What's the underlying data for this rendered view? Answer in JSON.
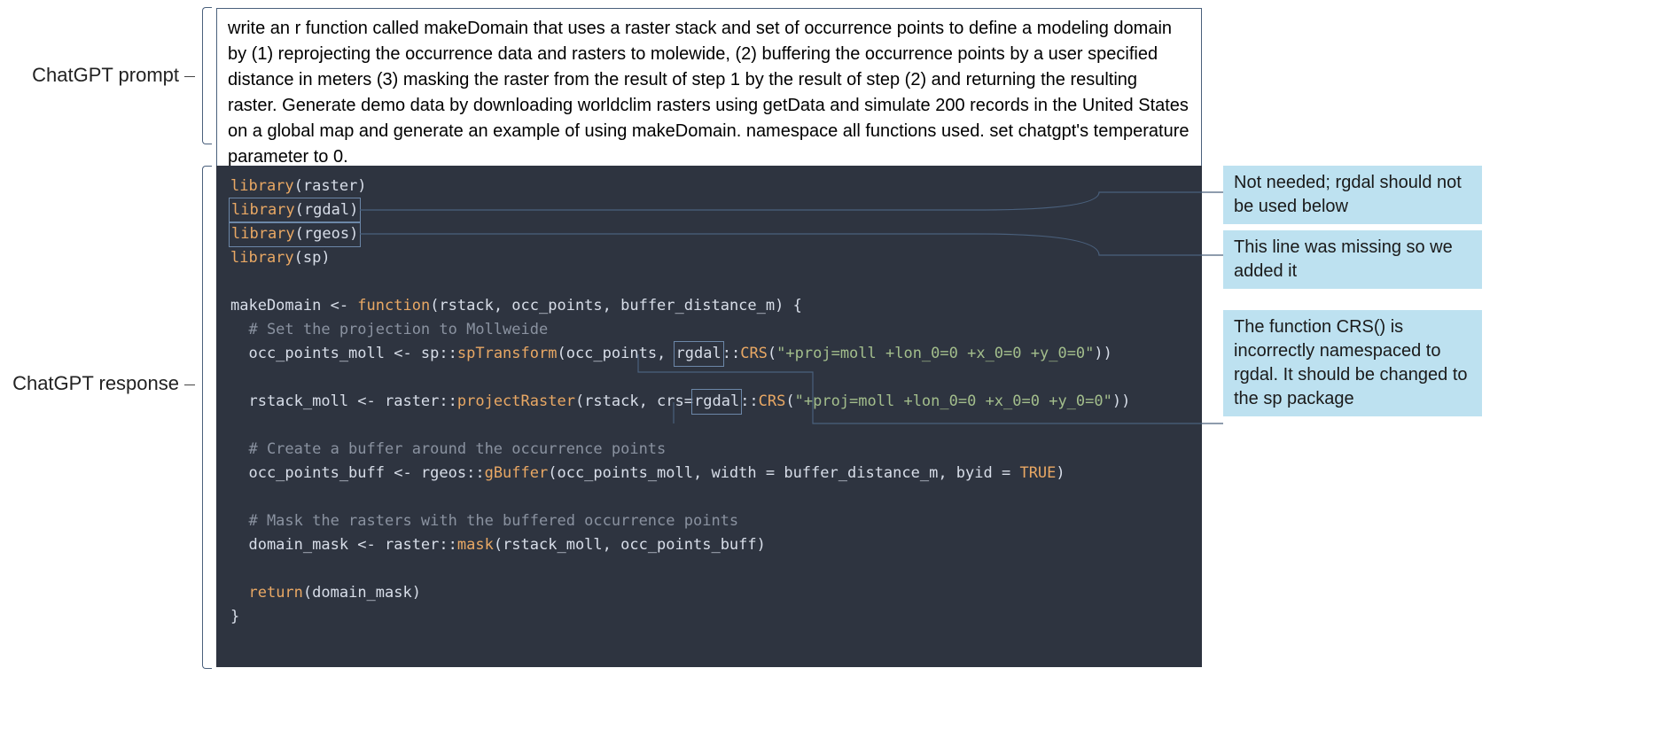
{
  "labels": {
    "prompt": "ChatGPT prompt",
    "response": "ChatGPT response"
  },
  "prompt_text": "write an r function called makeDomain that uses a raster stack and set of occurrence points to define a modeling domain by (1) reprojecting the occurrence data and rasters to molewide, (2) buffering the occurrence points by a user specified distance in meters (3) masking the raster from the result of step 1 by the result of step (2) and returning the resulting raster. Generate demo data by downloading worldclim rasters using getData and simulate 200 records in the United States on a global map and generate an example of using makeDomain. namespace all functions used. set chatgpt's temperature parameter to 0.",
  "code": {
    "l1_fn": "library",
    "l1_arg": "(raster)",
    "l2_fn": "library",
    "l2_arg": "(rgdal)",
    "l3_fn": "library",
    "l3_arg": "(rgeos)",
    "l4_fn": "library",
    "l4_arg": "(sp)",
    "l6a": "makeDomain <- ",
    "l6_kw": "function",
    "l6b": "(rstack, occ_points, buffer_distance_m) {",
    "l7": "  # Set the projection to Mollweide",
    "l8a": "  occ_points_moll <- sp::",
    "l8_fn": "spTransform",
    "l8b": "(occ_points, ",
    "l8_hl": "rgdal",
    "l8c": "::",
    "l8_fn2": "CRS",
    "l8d": "(",
    "l8_str": "\"+proj=moll +lon_0=0 +x_0=0 +y_0=0\"",
    "l8e": "))",
    "l10a": "  rstack_moll <- raster::",
    "l10_fn": "projectRaster",
    "l10b": "(rstack, crs=",
    "l10_hl": "rgdal",
    "l10c": "::",
    "l10_fn2": "CRS",
    "l10d": "(",
    "l10_str": "\"+proj=moll +lon_0=0 +x_0=0 +y_0=0\"",
    "l10e": "))",
    "l12": "  # Create a buffer around the occurrence points",
    "l13a": "  occ_points_buff <- rgeos::",
    "l13_fn": "gBuffer",
    "l13b": "(occ_points_moll, width = buffer_distance_m, byid = ",
    "l13_bool": "TRUE",
    "l13c": ")",
    "l15": "  # Mask the rasters with the buffered occurrence points",
    "l16a": "  domain_mask <- raster::",
    "l16_fn": "mask",
    "l16b": "(rstack_moll, occ_points_buff)",
    "l18a": "  ",
    "l18_fn": "return",
    "l18b": "(domain_mask)",
    "l19": "}"
  },
  "annotations": {
    "a1": "Not needed; rgdal should not be used below",
    "a2": "This line was missing so we added it",
    "a3": "The function CRS() is incorrectly namespaced to rgdal. It should be changed to the sp package"
  }
}
